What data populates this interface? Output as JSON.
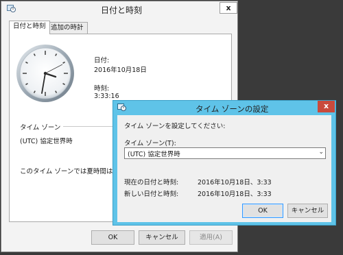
{
  "main_window": {
    "title": "日付と時刻",
    "close_label": "x",
    "tabs": [
      {
        "label": "日付と時刻",
        "active": true
      },
      {
        "label": "追加の時計",
        "active": false
      }
    ],
    "date_label": "日付:",
    "date_value": "2016年10月18日",
    "time_label": "時刻:",
    "time_value": "3:33:16",
    "timezone_group_label": "タイム ゾーン",
    "timezone_value": "(UTC) 協定世界時",
    "dst_note": "このタイム ゾーンでは夏時間は実施さ",
    "buttons": {
      "ok": "OK",
      "cancel": "キャンセル",
      "apply": "適用(A)"
    }
  },
  "tz_dialog": {
    "title": "タイム ゾーンの設定",
    "close_label": "x",
    "prompt": "タイム ゾーンを設定してください:",
    "field_label": "タイム ゾーン(T):",
    "selected_timezone": "(UTC) 協定世界時",
    "current_label": "現在の日付と時刻:",
    "current_value": "2016年10月18日、3:33",
    "new_label": "新しい日付と時刻:",
    "new_value": "2016年10月18日、3:33",
    "buttons": {
      "ok": "OK",
      "cancel": "キャンセル"
    }
  },
  "icons": {
    "app_icon": "date-time-icon",
    "dropdown_arrow": "chevron-down-icon"
  },
  "colors": {
    "tz_title_bar": "#5fc3e8",
    "tz_close": "#c94a3c",
    "default_button_border": "#3399ff"
  }
}
